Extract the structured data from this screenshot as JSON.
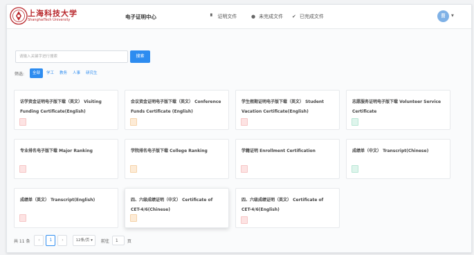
{
  "brand": {
    "name_cn": "上海科技大学",
    "name_en": "ShanghaiTech University"
  },
  "app_title": "电子证明中心",
  "nav": [
    {
      "icon": "file-icon",
      "glyph": "▘",
      "label": "证明文件"
    },
    {
      "icon": "clock-icon",
      "glyph": "●",
      "label": "未完成文件"
    },
    {
      "icon": "check-circle-icon",
      "glyph": "✔",
      "label": "已完成文件"
    }
  ],
  "user": {
    "avatar_text": "曹",
    "caret": "▼"
  },
  "search": {
    "placeholder": "请输入关键字进行搜索",
    "button": "搜索"
  },
  "filter": {
    "label": "筛选:",
    "options": [
      "全部",
      "学工",
      "教务",
      "人事",
      "研究生"
    ],
    "active_index": 0
  },
  "cards": [
    {
      "title": "访学资金证明电子版下载（英文） Visiting Funding Certificate(English)",
      "badge_color": "red"
    },
    {
      "title": "会议资金证明电子版下载（英文） Conference Funds Certificate (English)",
      "badge_color": "orange"
    },
    {
      "title": "学生假期证明电子版下载（英文） Student Vacation Certificate(English)",
      "badge_color": "red"
    },
    {
      "title": "志愿服务证明电子版下载 Volunteer Service Certificate",
      "badge_color": "green"
    },
    {
      "title": "专业排名电子版下载 Major Ranking",
      "badge_color": "red"
    },
    {
      "title": "学院排名电子版下载 College Ranking",
      "badge_color": "orange"
    },
    {
      "title": "学籍证明 Enrollment Certification",
      "badge_color": "red"
    },
    {
      "title": "成绩单（中文） Transcript(Chinese)",
      "badge_color": "green"
    },
    {
      "title": "成绩单（英文） Transcript(English)",
      "badge_color": "red"
    },
    {
      "title": "四、六级成绩证明（中文） Certificate of CET-4/6(Chinese)",
      "badge_color": "orange"
    },
    {
      "title": "四、六级成绩证明（英文） Certificate of CET-4/6(English)",
      "badge_color": "red"
    }
  ],
  "pagination": {
    "total_text": "共 11 条",
    "prev": "‹",
    "current_page": "1",
    "next": "›",
    "page_size": "12条/页",
    "page_size_caret": "▾",
    "goto_label": "前往",
    "goto_value": "1",
    "page_unit": "页"
  }
}
